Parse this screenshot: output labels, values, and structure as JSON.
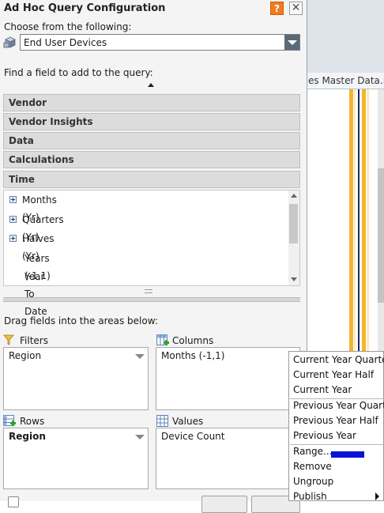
{
  "dialog": {
    "title": "Ad Hoc Query Configuration",
    "help_label": "?",
    "close_label": "✕",
    "choose_label": "Choose from the following:",
    "source_value": "End User Devices",
    "find_label": "Find a field to add to the query:",
    "drag_label": "Drag fields into the areas below:"
  },
  "categories": [
    "Vendor",
    "Vendor Insights",
    "Data",
    "Calculations",
    "Time"
  ],
  "time_fields": [
    {
      "label": "Months (Yr)",
      "expandable": true
    },
    {
      "label": "Quarters (Yr)",
      "expandable": true
    },
    {
      "label": "Halves (Yr)",
      "expandable": true
    },
    {
      "label": "Years (-1,1)",
      "expandable": false
    },
    {
      "label": "Year To Date",
      "expandable": false
    }
  ],
  "areas": {
    "filters": {
      "label": "Filters",
      "item": "Region"
    },
    "columns": {
      "label": "Columns",
      "item": "Months (-1,1)"
    },
    "rows": {
      "label": "Rows",
      "item": "Region"
    },
    "values": {
      "label": "Values",
      "item": "Device Count"
    }
  },
  "background": {
    "tab_label": "es Master Data.De"
  },
  "context_menu": {
    "items": [
      "Current Year Quarter",
      "Current Year Half",
      "Current Year",
      "Previous Year Quarter",
      "Previous Year Half",
      "Previous Year",
      "Range...",
      "Remove",
      "Ungroup",
      "Publish"
    ],
    "range_color": "#0a14d6"
  },
  "colors": {
    "help_button": "#f07b1f",
    "category_bg": "#dcdcdc",
    "accent_orange": "#f2b431",
    "accent_navy": "#1d2a5e"
  }
}
